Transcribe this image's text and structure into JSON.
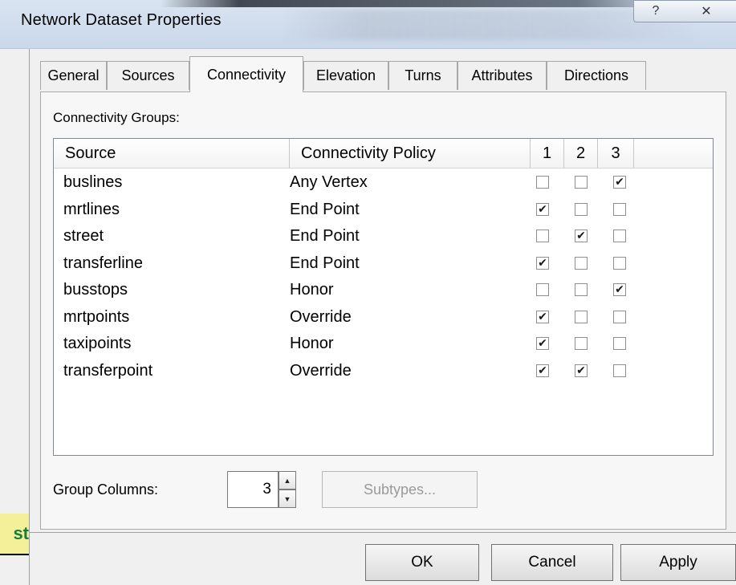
{
  "window": {
    "title": "Network Dataset Properties",
    "help_glyph": "?",
    "close_glyph": "✕"
  },
  "tabs": [
    {
      "label": "General"
    },
    {
      "label": "Sources"
    },
    {
      "label": "Connectivity",
      "active": true
    },
    {
      "label": "Elevation"
    },
    {
      "label": "Turns"
    },
    {
      "label": "Attributes"
    },
    {
      "label": "Directions"
    }
  ],
  "connectivity": {
    "groups_label": "Connectivity Groups:",
    "columns": [
      "Source",
      "Connectivity Policy",
      "1",
      "2",
      "3"
    ],
    "rows": [
      {
        "source": "buslines",
        "policy": "Any Vertex",
        "groups": [
          false,
          false,
          true
        ]
      },
      {
        "source": "mrtlines",
        "policy": "End Point",
        "groups": [
          true,
          false,
          false
        ]
      },
      {
        "source": "street",
        "policy": "End Point",
        "groups": [
          false,
          true,
          false
        ]
      },
      {
        "source": "transferline",
        "policy": "End Point",
        "groups": [
          true,
          false,
          false
        ]
      },
      {
        "source": "busstops",
        "policy": "Honor",
        "groups": [
          false,
          false,
          true
        ]
      },
      {
        "source": "mrtpoints",
        "policy": "Override",
        "groups": [
          true,
          false,
          false
        ]
      },
      {
        "source": "taxipoints",
        "policy": "Honor",
        "groups": [
          true,
          false,
          false
        ]
      },
      {
        "source": "transferpoint",
        "policy": "Override",
        "groups": [
          true,
          true,
          false
        ]
      }
    ],
    "group_columns_label": "Group Columns:",
    "group_columns_value": "3",
    "subtypes_label": "Subtypes..."
  },
  "buttons": {
    "ok": "OK",
    "cancel": "Cancel",
    "apply": "Apply"
  },
  "background_fragment": "st",
  "colors": {
    "accent_fragment_bg": "#f4f09a",
    "accent_fragment_text": "#1d7b3a"
  }
}
